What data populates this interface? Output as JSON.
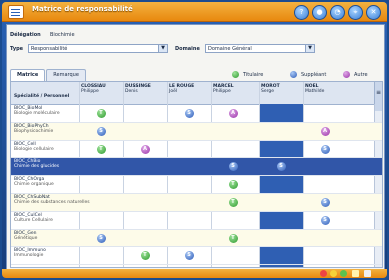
{
  "window": {
    "title": "Matrice de responsabilité",
    "controls": [
      "?",
      "●",
      "◔",
      "⌖",
      "✕"
    ]
  },
  "form": {
    "delegation_label": "Délégation",
    "delegation_value": "Biochimie",
    "type_label": "Type",
    "type_value": "Responsabilité",
    "domain_label": "Domaine",
    "domain_value": "Domaine Général"
  },
  "tabs": [
    "Matrice",
    "Remarque"
  ],
  "legend": [
    {
      "code": "T",
      "label": "Titulaire",
      "color": "#2e9a2e"
    },
    {
      "code": "S",
      "label": "Suppléant",
      "color": "#2e5cb8"
    },
    {
      "code": "A",
      "label": "Autre",
      "color": "#9a34a8"
    }
  ],
  "grid": {
    "first_header": "Spécialité / Personnel",
    "columns": [
      {
        "name": "CLOSSIAU",
        "sub": "Philippe"
      },
      {
        "name": "DUSSINGE",
        "sub": "Denis"
      },
      {
        "name": "LE ROUGE",
        "sub": "Joël"
      },
      {
        "name": "MARCEL",
        "sub": "Philippe"
      },
      {
        "name": "MOROT",
        "sub": "Serge"
      },
      {
        "name": "NOEL",
        "sub": "Mathilde"
      }
    ],
    "rows": [
      {
        "code": "BIOC_BioMol",
        "name": "Biologie moléculaire",
        "cells": [
          "T",
          "",
          "S",
          "A",
          "",
          ""
        ]
      },
      {
        "code": "BIOC_BioPhyCh",
        "name": "Biophysicochimie",
        "cells": [
          "S",
          "",
          "",
          "",
          "",
          "A"
        ]
      },
      {
        "code": "BIOC_Cell",
        "name": "Biologie cellulaire",
        "cells": [
          "T",
          "A",
          "",
          "",
          "",
          "S"
        ]
      },
      {
        "code": "BIOC_ChBio",
        "name": "Chimie des glucides",
        "cells": [
          "",
          "",
          "",
          "S",
          "S",
          ""
        ]
      },
      {
        "code": "BIOC_ChOrga",
        "name": "Chimie organique",
        "cells": [
          "",
          "",
          "",
          "T",
          "",
          ""
        ]
      },
      {
        "code": "BIOC_ChSubNat",
        "name": "Chimie des substances naturelles",
        "cells": [
          "",
          "",
          "",
          "T",
          "",
          "S"
        ]
      },
      {
        "code": "BIOC_CulCel",
        "name": "Culture Cellulaire",
        "cells": [
          "",
          "",
          "",
          "",
          "",
          "S"
        ]
      },
      {
        "code": "BIOC_Gen",
        "name": "Génétique",
        "cells": [
          "S",
          "",
          "",
          "T",
          "",
          ""
        ]
      },
      {
        "code": "BIOC_Immuno",
        "name": "Immunologie",
        "cells": [
          "",
          "T",
          "S",
          "",
          "",
          ""
        ]
      }
    ],
    "selected_row": 3,
    "highlighted_column": 4
  }
}
